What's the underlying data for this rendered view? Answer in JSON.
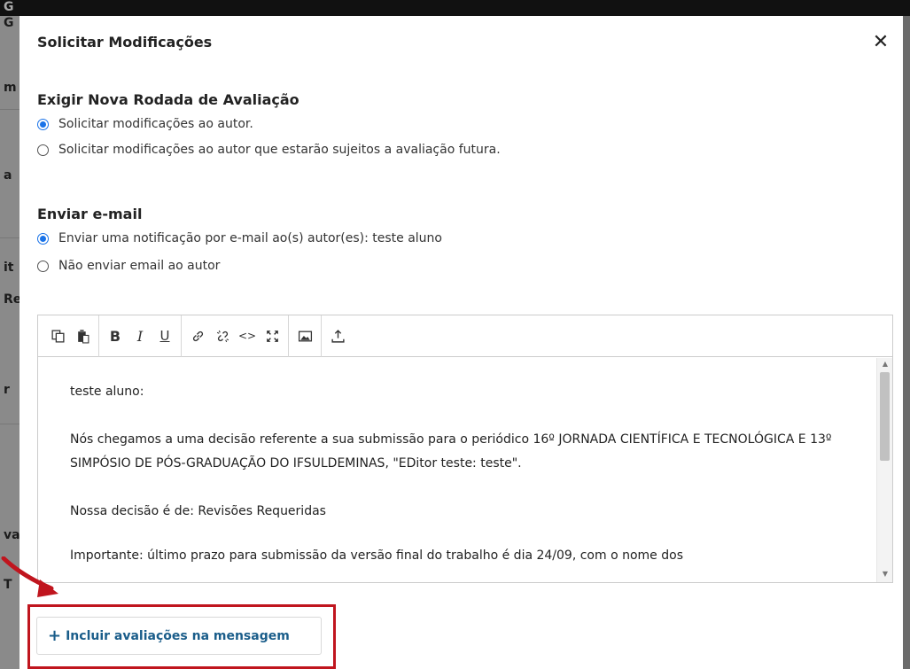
{
  "background": {
    "top_fragment": "G",
    "left_fragments": [
      "G",
      "m",
      "a",
      "it",
      "Re",
      "r",
      "va",
      "T"
    ]
  },
  "modal": {
    "title": "Solicitar Modificações",
    "close_icon": "close-icon",
    "review_section": {
      "title": "Exigir Nova Rodada de Avaliação",
      "options": [
        {
          "label": "Solicitar modificações ao autor.",
          "checked": true
        },
        {
          "label": "Solicitar modificações ao autor que estarão sujeitos a avaliação futura.",
          "checked": false
        }
      ]
    },
    "email_section": {
      "title": "Enviar e-mail",
      "options": [
        {
          "label": "Enviar uma notificação por e-mail ao(s) autor(es): teste aluno",
          "checked": true
        },
        {
          "label": "Não enviar email ao autor",
          "checked": false
        }
      ]
    },
    "editor": {
      "toolbar_icons": [
        "copy-icon",
        "paste-icon",
        "bold-icon",
        "italic-icon",
        "underline-icon",
        "link-icon",
        "unlink-icon",
        "code-icon",
        "fullscreen-icon",
        "image-icon",
        "upload-icon"
      ],
      "toolbar_glyphs": {
        "bold": "B",
        "italic": "I",
        "underline": "U",
        "code": "<>"
      },
      "paragraphs": [
        "teste aluno:",
        "Nós chegamos a uma decisão referente a sua submissão para o periódico 16º JORNADA CIENTÍFICA E TECNOLÓGICA E 13º SIMPÓSIO DE PÓS-GRADUAÇÃO DO IFSULDEMINAS, \"EDitor teste: teste\".",
        "Nossa decisão é de: Revisões Requeridas",
        "Importante: último prazo para submissão da versão final do trabalho é dia 24/09, com o nome dos"
      ]
    },
    "include_reviews_button": {
      "plus": "+",
      "label": "Incluir avaliações na mensagem"
    }
  },
  "colors": {
    "accent": "#1a73e8",
    "link_button": "#1a5d8a",
    "highlight": "#c0151e"
  }
}
